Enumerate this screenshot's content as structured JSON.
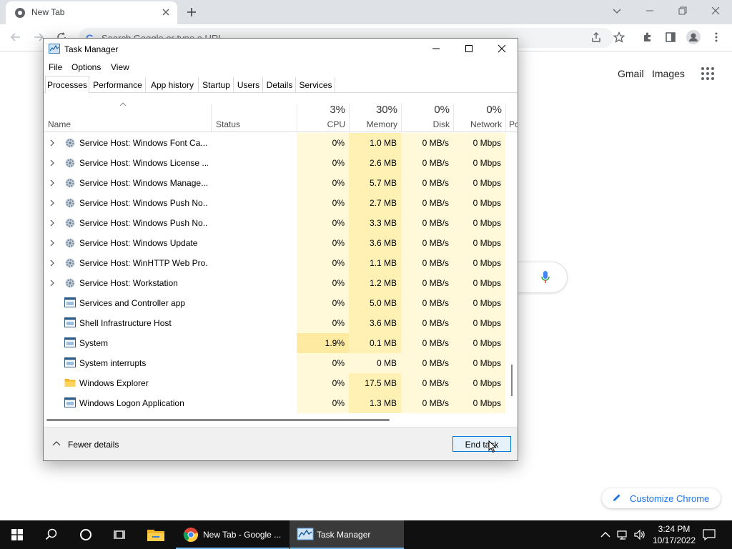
{
  "browser": {
    "tab_title": "New Tab",
    "omnibox_placeholder": "Search Google or type a URL",
    "links": {
      "gmail": "Gmail",
      "images": "Images"
    },
    "customize_label": "Customize Chrome"
  },
  "taskmanager": {
    "title": "Task Manager",
    "menu": [
      "File",
      "Options",
      "View"
    ],
    "tabs": [
      "Processes",
      "Performance",
      "App history",
      "Startup",
      "Users",
      "Details",
      "Services"
    ],
    "active_tab": "Processes",
    "columns": {
      "name": "Name",
      "status": "Status",
      "cpu": {
        "label": "CPU",
        "percent": "3%"
      },
      "memory": {
        "label": "Memory",
        "percent": "30%"
      },
      "disk": {
        "label": "Disk",
        "percent": "0%"
      },
      "network": {
        "label": "Network",
        "percent": "0%"
      },
      "power": "Po"
    },
    "rows": [
      {
        "name": "Service Host: Windows Font Ca...",
        "cpu": "0%",
        "memory": "1.0 MB",
        "disk": "0 MB/s",
        "network": "0 Mbps",
        "expandable": true,
        "icon": "gear-icon"
      },
      {
        "name": "Service Host: Windows License ...",
        "cpu": "0%",
        "memory": "2.6 MB",
        "disk": "0 MB/s",
        "network": "0 Mbps",
        "expandable": true,
        "icon": "gear-icon"
      },
      {
        "name": "Service Host: Windows Manage...",
        "cpu": "0%",
        "memory": "5.7 MB",
        "disk": "0 MB/s",
        "network": "0 Mbps",
        "expandable": true,
        "icon": "gear-icon"
      },
      {
        "name": "Service Host: Windows Push No...",
        "cpu": "0%",
        "memory": "2.7 MB",
        "disk": "0 MB/s",
        "network": "0 Mbps",
        "expandable": true,
        "icon": "gear-icon"
      },
      {
        "name": "Service Host: Windows Push No...",
        "cpu": "0%",
        "memory": "3.3 MB",
        "disk": "0 MB/s",
        "network": "0 Mbps",
        "expandable": true,
        "icon": "gear-icon"
      },
      {
        "name": "Service Host: Windows Update",
        "cpu": "0%",
        "memory": "3.6 MB",
        "disk": "0 MB/s",
        "network": "0 Mbps",
        "expandable": true,
        "icon": "gear-icon"
      },
      {
        "name": "Service Host: WinHTTP Web Pro...",
        "cpu": "0%",
        "memory": "1.1 MB",
        "disk": "0 MB/s",
        "network": "0 Mbps",
        "expandable": true,
        "icon": "gear-icon"
      },
      {
        "name": "Service Host: Workstation",
        "cpu": "0%",
        "memory": "1.2 MB",
        "disk": "0 MB/s",
        "network": "0 Mbps",
        "expandable": true,
        "icon": "gear-icon"
      },
      {
        "name": "Services and Controller app",
        "cpu": "0%",
        "memory": "5.0 MB",
        "disk": "0 MB/s",
        "network": "0 Mbps",
        "expandable": false,
        "icon": "window-icon"
      },
      {
        "name": "Shell Infrastructure Host",
        "cpu": "0%",
        "memory": "3.6 MB",
        "disk": "0 MB/s",
        "network": "0 Mbps",
        "expandable": false,
        "icon": "window-icon"
      },
      {
        "name": "System",
        "cpu": "1.9%",
        "memory": "0.1 MB",
        "disk": "0 MB/s",
        "network": "0 Mbps",
        "expandable": false,
        "icon": "window-icon"
      },
      {
        "name": "System interrupts",
        "cpu": "0%",
        "memory": "0 MB",
        "disk": "0 MB/s",
        "network": "0 Mbps",
        "expandable": false,
        "icon": "window-icon"
      },
      {
        "name": "Windows Explorer",
        "cpu": "0%",
        "memory": "17.5 MB",
        "disk": "0 MB/s",
        "network": "0 Mbps",
        "expandable": false,
        "icon": "folder-icon"
      },
      {
        "name": "Windows Logon Application",
        "cpu": "0%",
        "memory": "1.3 MB",
        "disk": "0 MB/s",
        "network": "0 Mbps",
        "expandable": false,
        "icon": "window-icon"
      }
    ],
    "fewer_details": "Fewer details",
    "end_task": "End task"
  },
  "taskbar": {
    "apps": [
      {
        "label": "New Tab - Google ...",
        "icon": "chrome-icon"
      },
      {
        "label": "Task Manager",
        "icon": "taskmanager-icon"
      }
    ],
    "time": "3:24 PM",
    "date": "10/17/2022"
  },
  "colors": {
    "cell_light": "#fff9d9",
    "cell_medium": "#fff0b4",
    "cell_warm": "#ffeaa1",
    "taskbar": "#101010",
    "accent": "#1a73e8"
  }
}
